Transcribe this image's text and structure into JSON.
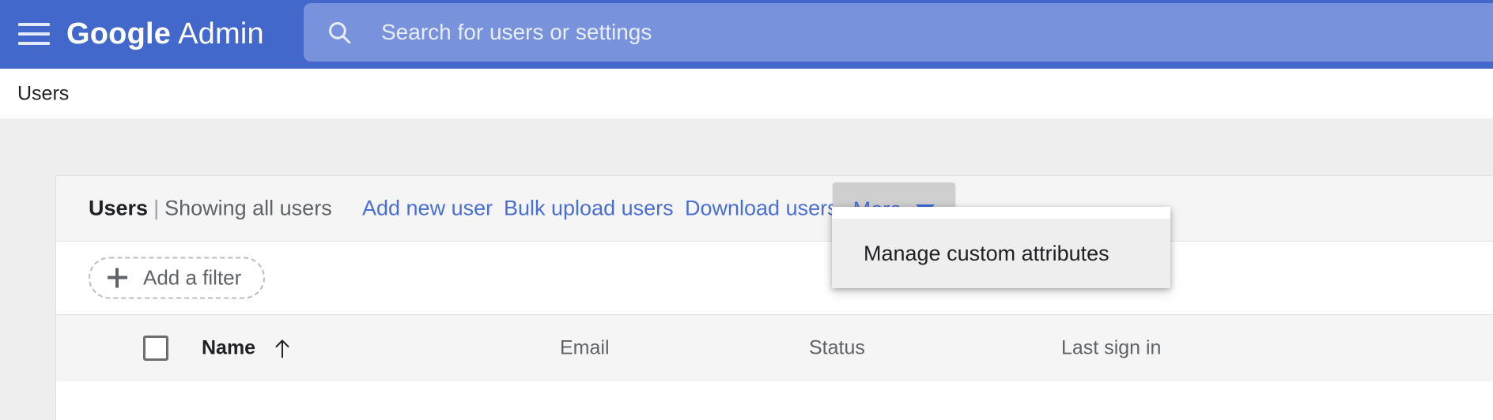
{
  "appbar": {
    "menu_icon": "hamburger-menu-icon",
    "brand_primary": "Google",
    "brand_secondary": "Admin",
    "search": {
      "icon": "search-icon",
      "placeholder": "Search for users or settings",
      "value": ""
    },
    "bg_color": "#4168ca",
    "search_bg_color": "#7892dc"
  },
  "breadcrumb": {
    "label": "Users"
  },
  "toolbar": {
    "title_main": "Users",
    "title_separator": "|",
    "title_sub": "Showing all users",
    "links": [
      {
        "label": "Add new user"
      },
      {
        "label": "Bulk upload users"
      },
      {
        "label": "Download users"
      }
    ],
    "more_button": {
      "label": "More",
      "caret_icon": "chevron-down-icon",
      "expanded": true
    },
    "link_color": "#4a6fd4"
  },
  "filter": {
    "add_filter_label": "Add a filter",
    "plus_icon": "plus-icon"
  },
  "table": {
    "select_all_checkbox": {
      "checked": false
    },
    "columns": [
      {
        "label": "Name",
        "sorted": true,
        "sort_direction": "asc",
        "sort_icon": "arrow-up-icon"
      },
      {
        "label": "Email",
        "sorted": false
      },
      {
        "label": "Status",
        "sorted": false
      },
      {
        "label": "Last sign in",
        "sorted": false
      }
    ],
    "rows": []
  },
  "dropdown_menu": {
    "visible": true,
    "items": [
      {
        "label": "Manage custom attributes",
        "highlighted": true
      }
    ]
  }
}
